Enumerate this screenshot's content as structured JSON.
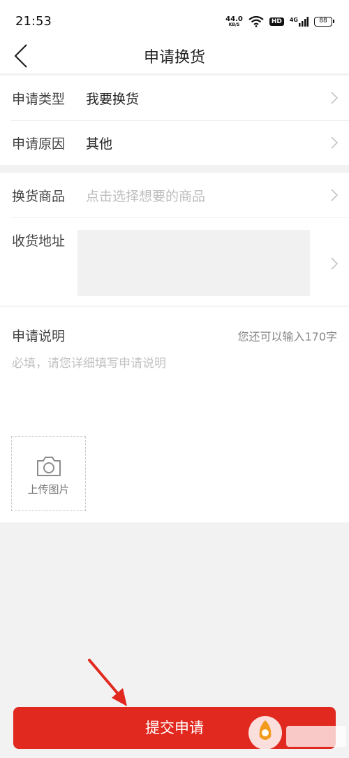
{
  "status_bar": {
    "time": "21:53",
    "net_speed": "44.0",
    "net_unit": "KB/S",
    "hd": "HD",
    "signal": "4G",
    "battery": "88"
  },
  "nav": {
    "back_icon": "chevron-left-icon",
    "title": "申请换货"
  },
  "form": {
    "type_row": {
      "label": "申请类型",
      "value": "我要换货"
    },
    "reason_row": {
      "label": "申请原因",
      "value": "其他"
    },
    "product_row": {
      "label": "换货商品",
      "placeholder": "点击选择想要的商品"
    },
    "address_row": {
      "label": "收货地址"
    }
  },
  "description": {
    "label": "申请说明",
    "counter": "您还可以输入170字",
    "placeholder": "必填，请您详细填写申请说明",
    "upload_icon": "camera-icon",
    "upload_label": "上传图片"
  },
  "submit": {
    "label": "提交申请"
  },
  "colors": {
    "accent": "#e1291f",
    "page_bg": "#f2f2f2",
    "placeholder": "#bdbdbd"
  }
}
